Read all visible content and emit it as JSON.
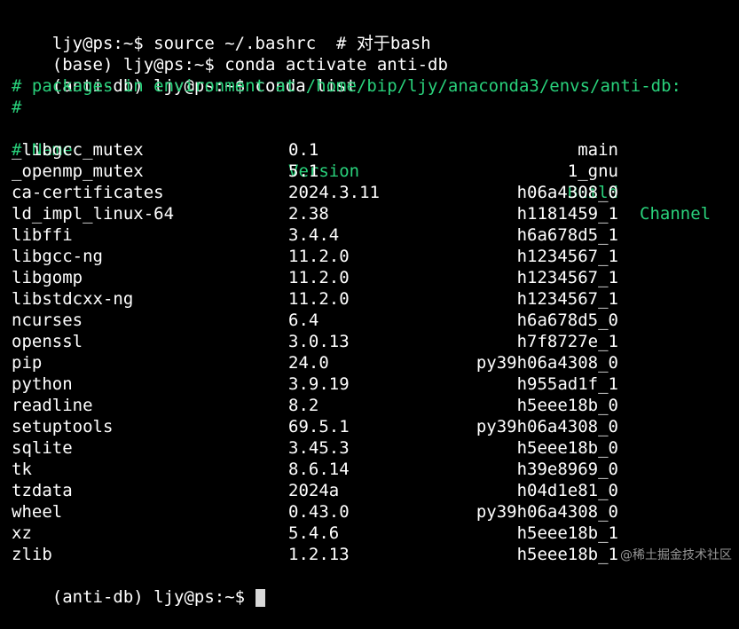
{
  "terminal": {
    "commands": [
      {
        "prompt": "ljy@ps:~$ ",
        "text": "source ~/.bashrc  # 对于bash"
      },
      {
        "prompt": "(base) ljy@ps:~$ ",
        "text": "conda activate anti-db"
      },
      {
        "prompt": "(anti-db) ljy@ps:~$ ",
        "text": "conda list"
      }
    ],
    "header_lines": [
      "# packages in environment at /home/bip/ljy/anaconda3/envs/anti-db:",
      "#"
    ],
    "columns": {
      "name": "# Name",
      "version": "Version",
      "build": "Build",
      "channel": "Channel"
    },
    "packages": [
      {
        "name": "_libgcc_mutex",
        "version": "0.1",
        "build": "main"
      },
      {
        "name": "_openmp_mutex",
        "version": "5.1",
        "build": "1_gnu"
      },
      {
        "name": "ca-certificates",
        "version": "2024.3.11",
        "build": "h06a4308_0"
      },
      {
        "name": "ld_impl_linux-64",
        "version": "2.38",
        "build": "h1181459_1"
      },
      {
        "name": "libffi",
        "version": "3.4.4",
        "build": "h6a678d5_1"
      },
      {
        "name": "libgcc-ng",
        "version": "11.2.0",
        "build": "h1234567_1"
      },
      {
        "name": "libgomp",
        "version": "11.2.0",
        "build": "h1234567_1"
      },
      {
        "name": "libstdcxx-ng",
        "version": "11.2.0",
        "build": "h1234567_1"
      },
      {
        "name": "ncurses",
        "version": "6.4",
        "build": "h6a678d5_0"
      },
      {
        "name": "openssl",
        "version": "3.0.13",
        "build": "h7f8727e_1"
      },
      {
        "name": "pip",
        "version": "24.0",
        "build": "py39h06a4308_0"
      },
      {
        "name": "python",
        "version": "3.9.19",
        "build": "h955ad1f_1"
      },
      {
        "name": "readline",
        "version": "8.2",
        "build": "h5eee18b_0"
      },
      {
        "name": "setuptools",
        "version": "69.5.1",
        "build": "py39h06a4308_0"
      },
      {
        "name": "sqlite",
        "version": "3.45.3",
        "build": "h5eee18b_0"
      },
      {
        "name": "tk",
        "version": "8.6.14",
        "build": "h39e8969_0"
      },
      {
        "name": "tzdata",
        "version": "2024a",
        "build": "h04d1e81_0"
      },
      {
        "name": "wheel",
        "version": "0.43.0",
        "build": "py39h06a4308_0"
      },
      {
        "name": "xz",
        "version": "5.4.6",
        "build": "h5eee18b_1"
      },
      {
        "name": "zlib",
        "version": "1.2.13",
        "build": "h5eee18b_1"
      }
    ],
    "final_prompt": "(anti-db) ljy@ps:~$ "
  },
  "watermark": "@稀土掘金技术社区",
  "colors": {
    "background": "#000000",
    "text": "#ffffff",
    "comment": "#29d17b",
    "cursor": "#d9d9d9"
  }
}
